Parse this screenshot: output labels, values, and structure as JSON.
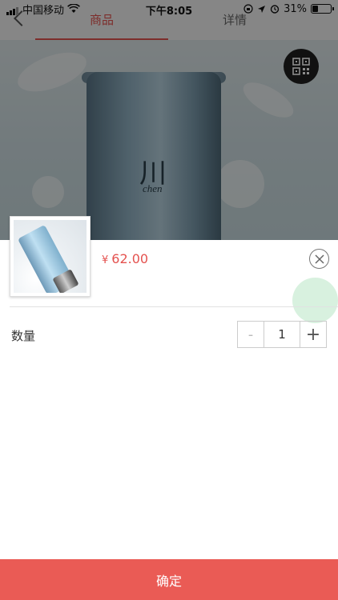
{
  "status_bar": {
    "carrier": "中国移动",
    "time": "下午8:05",
    "battery_text": "31%",
    "battery_level": 0.31
  },
  "header": {
    "tabs": [
      {
        "label": "商品",
        "active": true
      },
      {
        "label": "详情",
        "active": false
      }
    ]
  },
  "hero": {
    "logo_text": "川",
    "brand_text": "chen"
  },
  "sheet": {
    "currency_symbol": "¥",
    "price": "62.00",
    "quantity_label": "数量",
    "quantity_minus": "-",
    "quantity_value": "1",
    "quantity_plus": "+",
    "confirm_label": "确定"
  },
  "colors": {
    "accent": "#e4524f",
    "confirm_button": "#ea5b55"
  }
}
